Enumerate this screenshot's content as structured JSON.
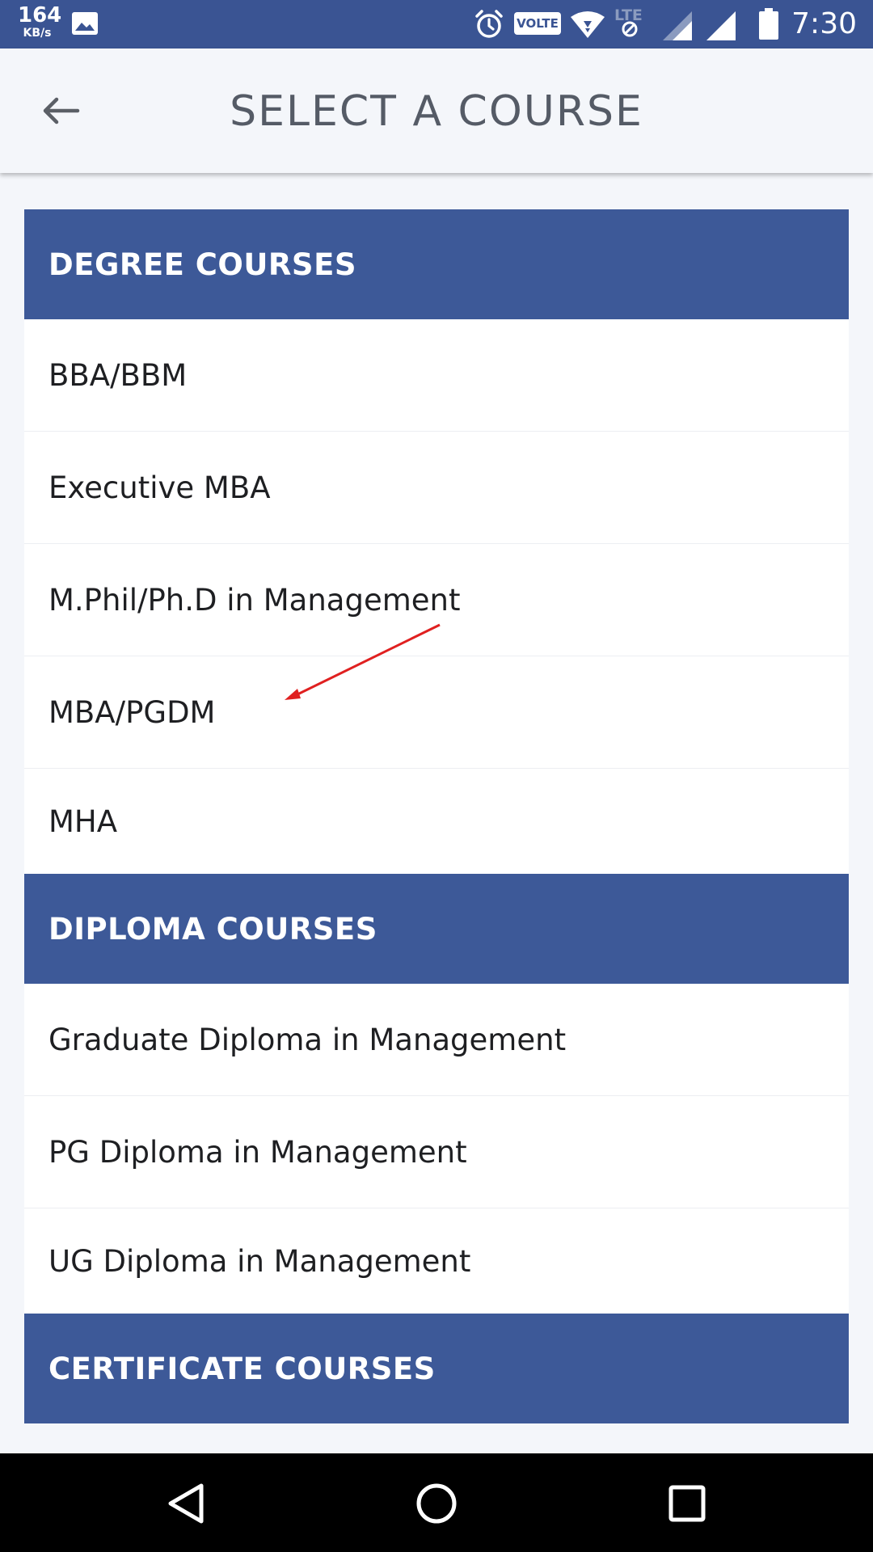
{
  "status_bar": {
    "speed_value": "164",
    "speed_unit": "KB/s",
    "volte_label": "VOLTE",
    "lte_label": "LTE",
    "time": "7:30",
    "icons": [
      "gallery-icon",
      "alarm-icon",
      "wifi-icon",
      "signal-icon",
      "battery-icon"
    ]
  },
  "app_bar": {
    "title": "SELECT A COURSE",
    "back_icon": "back-arrow-icon"
  },
  "sections": [
    {
      "header": "DEGREE COURSES",
      "items": [
        "BBA/BBM",
        "Executive MBA",
        "M.Phil/Ph.D in Management",
        "MBA/PGDM",
        "MHA"
      ]
    },
    {
      "header": "DIPLOMA COURSES",
      "items": [
        "Graduate Diploma in Management",
        "PG Diploma in Management",
        "UG Diploma in Management"
      ]
    },
    {
      "header": "CERTIFICATE COURSES",
      "items": []
    }
  ],
  "nav_bar": {
    "icons": [
      "back-triangle-icon",
      "home-circle-icon",
      "recents-square-icon"
    ]
  },
  "colors": {
    "status_bar": "#3a5493",
    "section_header": "#3d5998",
    "annotation_arrow": "#e02020",
    "page_background": "#f4f6fa"
  }
}
